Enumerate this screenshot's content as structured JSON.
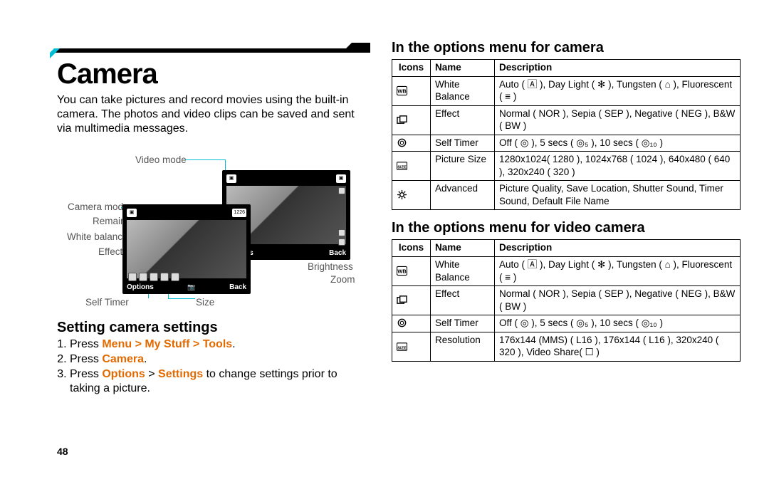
{
  "page_number": "48",
  "title": "Camera",
  "intro": "You can take pictures and record movies using the built-in camera. The photos and video clips can be saved and sent via multimedia messages.",
  "labels": {
    "video_mode": "Video mode",
    "camera_mode": "Camera mode",
    "remain": "Remain",
    "white_balance": "White balance",
    "effect": "Effect",
    "self_timer": "Self Timer",
    "size": "Size",
    "brightness": "Brightness",
    "zoom": "Zoom"
  },
  "softkeys": {
    "options": "Options",
    "back": "Back"
  },
  "counter": "1226",
  "heading_settings": "Setting camera settings",
  "steps_text": {
    "s1_pre": "Press ",
    "s1_link": "Menu > My Stuff > Tools",
    "s1_post": ".",
    "s2_pre": "Press ",
    "s2_link": "Camera",
    "s2_post": ".",
    "s3_pre": "Press ",
    "s3_link1": "Options",
    "s3_mid": " > ",
    "s3_link2": "Settings",
    "s3_post": " to change settings prior to taking a picture."
  },
  "heading_options_camera": "In the options menu for camera",
  "table_headers": {
    "icons": "Icons",
    "name": "Name",
    "description": "Description"
  },
  "camera_table": [
    {
      "name": "White Balance",
      "desc": "Auto ( 🄰 ), Day Light ( ✻ ), Tungsten ( ⌂ ), Fluorescent ( ≡ )"
    },
    {
      "name": "Effect",
      "desc": "Normal ( NOR ), Sepia ( SEP ), Negative ( NEG ), B&W ( BW )"
    },
    {
      "name": "Self Timer",
      "desc": "Off ( ◎ ), 5 secs ( ◎₅ ), 10 secs ( ◎₁₀ )"
    },
    {
      "name": "Picture Size",
      "desc": "1280x1024( 1280 ), 1024x768 ( 1024 ), 640x480 ( 640 ), 320x240 ( 320 )"
    },
    {
      "name": "Advanced",
      "desc": "Picture Quality, Save Location, Shutter Sound, Timer Sound, Default File Name"
    }
  ],
  "heading_options_video": "In the options menu for video camera",
  "video_table": [
    {
      "name": "White Balance",
      "desc": "Auto ( 🄰 ), Day Light ( ✻ ), Tungsten ( ⌂ ), Fluorescent ( ≡ )"
    },
    {
      "name": "Effect",
      "desc": "Normal ( NOR ), Sepia ( SEP ), Negative ( NEG ), B&W ( BW )"
    },
    {
      "name": "Self Timer",
      "desc": "Off ( ◎ ), 5 secs ( ◎₅ ), 10 secs ( ◎₁₀ )"
    },
    {
      "name": "Resolution",
      "desc": "176x144 (MMS) ( L16 ), 176x144 ( L16 ), 320x240 ( 320 ), Video Share( ☐ )"
    }
  ]
}
